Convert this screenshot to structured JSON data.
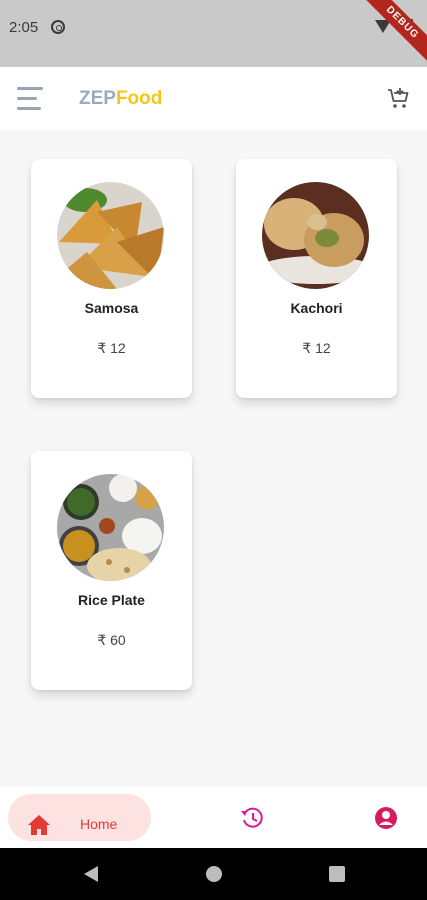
{
  "status_bar": {
    "time": "2:05",
    "debug_label": "DEBUG"
  },
  "app_bar": {
    "title_part1": "ZEP",
    "title_part2": "Food",
    "title_color1": "#9aa9c0",
    "title_color2": "#f5c518"
  },
  "items": [
    {
      "name": "Samosa",
      "price": "₹ 12",
      "image": "samosa-image"
    },
    {
      "name": "Kachori",
      "price": "₹ 12",
      "image": "kachori-image"
    },
    {
      "name": "Rice Plate",
      "price": "₹ 60",
      "image": "rice-plate-image"
    }
  ],
  "bottom_nav": {
    "home_label": "Home",
    "active_color": "#e53935",
    "history_icon": "history-icon",
    "profile_icon": "profile-icon"
  }
}
